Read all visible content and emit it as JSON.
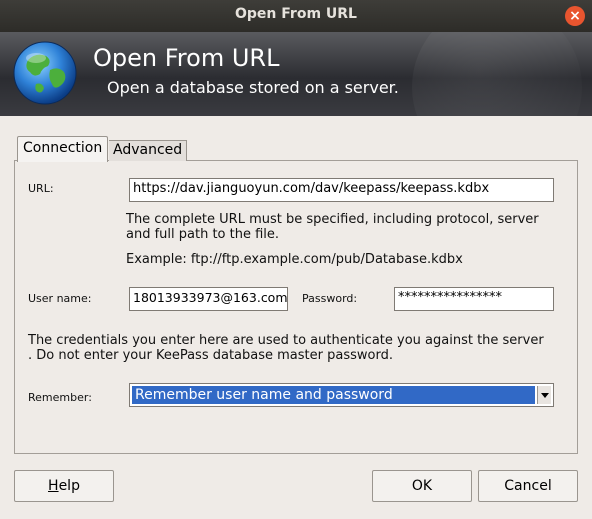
{
  "window": {
    "title": "Open From URL",
    "close_glyph": "×"
  },
  "banner": {
    "title": "Open From URL",
    "subtitle": "Open a database stored on a server.",
    "icon": "globe-icon"
  },
  "tabs": [
    {
      "label": "Connection",
      "active": true
    },
    {
      "label": "Advanced",
      "active": false
    }
  ],
  "connection": {
    "url_label": "URL:",
    "url_value": "https://dav.jianguoyun.com/dav/keepass/keepass.kdbx",
    "url_help_line1": "The complete URL must be specified, including protocol, server",
    "url_help_line2": "and full path to the file.",
    "example": "Example: ftp://ftp.example.com/pub/Database.kdbx",
    "username_label": "User name:",
    "username_value": "18013933973@163.com",
    "password_label": "Password:",
    "password_value": "****************",
    "credentials_note_line1": "The credentials you enter here are used to authenticate you against the server",
    "credentials_note_line2": ". Do not enter your KeePass database master password.",
    "remember_label": "Remember:",
    "remember_value": "Remember user name and password"
  },
  "buttons": {
    "help": "Help",
    "ok": "OK",
    "cancel": "Cancel"
  },
  "colors": {
    "selection": "#3169c6",
    "close_button": "#e8552f"
  }
}
